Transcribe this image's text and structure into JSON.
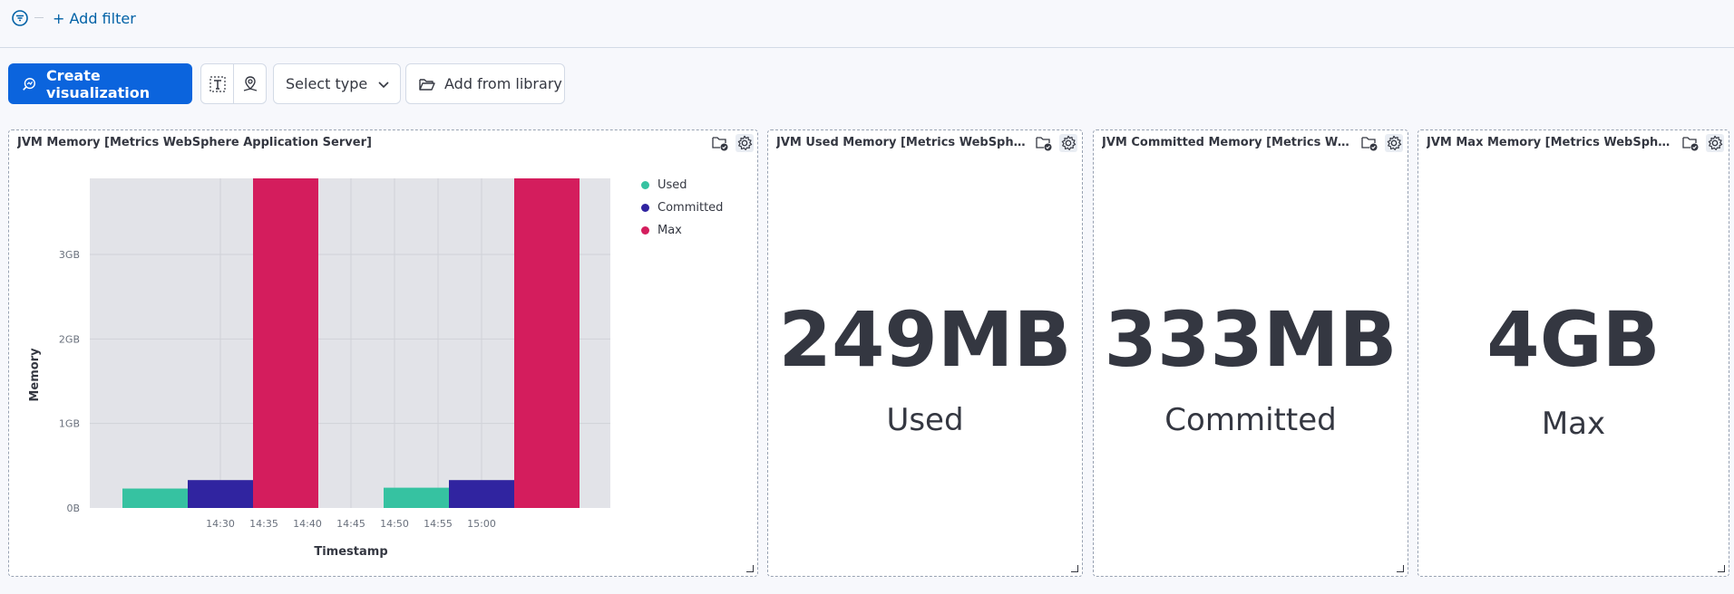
{
  "filterbar": {
    "add_filter_label": "+ Add filter"
  },
  "toolbar": {
    "create_label": "Create visualization",
    "select_type_label": "Select type",
    "add_library_label": "Add from library"
  },
  "panels": [
    {
      "title": "JVM Memory [Metrics WebSphere Application Server]"
    },
    {
      "title": "JVM Used Memory [Metrics WebSphere Application Server]",
      "value": "249MB",
      "label": "Used"
    },
    {
      "title": "JVM Committed Memory [Metrics WebSphere Application Server]",
      "value": "333MB",
      "label": "Committed"
    },
    {
      "title": "JVM Max Memory [Metrics WebSphere Application Server]",
      "value": "4GB",
      "label": "Max"
    }
  ],
  "chart_data": {
    "type": "bar",
    "xlabel": "Timestamp",
    "ylabel": "Memory",
    "y_ticks": [
      "0B",
      "1GB",
      "2GB",
      "3GB"
    ],
    "x_ticks": [
      "14:30",
      "14:35",
      "14:40",
      "14:45",
      "14:50",
      "14:55",
      "15:00"
    ],
    "ylim_gb": [
      0,
      3.9
    ],
    "grid": true,
    "legend_position": "right",
    "series": [
      {
        "name": "Used",
        "color": "#36c2a1"
      },
      {
        "name": "Committed",
        "color": "#3024a0"
      },
      {
        "name": "Max",
        "color": "#d41d5d"
      }
    ],
    "groups": [
      {
        "used_gb": 0.23,
        "committed_gb": 0.33,
        "max_gb": 3.9
      },
      {
        "used_gb": 0.24,
        "committed_gb": 0.33,
        "max_gb": 3.9
      }
    ]
  }
}
